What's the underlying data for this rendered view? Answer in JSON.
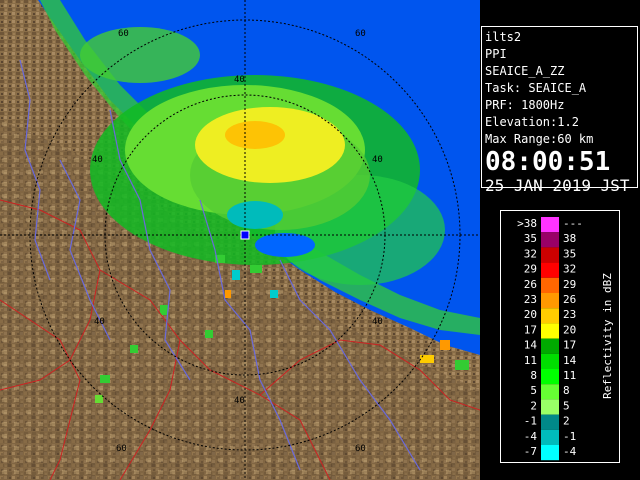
{
  "info": {
    "product": "ilts2",
    "mode": "PPI",
    "scan": "SEAICE_A_ZZ",
    "task": "Task: SEAICE_A",
    "prf": "PRF: 1800Hz",
    "elevation": "Elevation:1.2",
    "max_range": "Max Range:60 km",
    "time": "08:00:51",
    "date": "25 JAN 2019 JST"
  },
  "map": {
    "range_labels": [
      {
        "ring": 60,
        "text": "60"
      },
      {
        "ring": 40,
        "text": "40"
      },
      {
        "ring": 40,
        "text": "40"
      },
      {
        "ring": 60,
        "text": "60"
      },
      {
        "ring": 40,
        "text": "40"
      },
      {
        "ring": 40,
        "text": "40"
      },
      {
        "ring": 40,
        "text": "40"
      },
      {
        "ring": 60,
        "text": "60"
      },
      {
        "ring": 60,
        "text": "60"
      }
    ]
  },
  "legend": {
    "title": "Reflectivity in dBZ",
    "rows": [
      {
        "low": ">38",
        "high": "---",
        "color": "#ff33ff"
      },
      {
        "low": "35",
        "high": "38",
        "color": "#990066"
      },
      {
        "low": "32",
        "high": "35",
        "color": "#cc0000"
      },
      {
        "low": "29",
        "high": "32",
        "color": "#ff0000"
      },
      {
        "low": "26",
        "high": "29",
        "color": "#ff6600"
      },
      {
        "low": "23",
        "high": "26",
        "color": "#ff9900"
      },
      {
        "low": "20",
        "high": "23",
        "color": "#ffcc00"
      },
      {
        "low": "17",
        "high": "20",
        "color": "#ffff00"
      },
      {
        "low": "14",
        "high": "17",
        "color": "#00aa00"
      },
      {
        "low": "11",
        "high": "14",
        "color": "#00dd00"
      },
      {
        "low": "8",
        "high": "11",
        "color": "#00ff00"
      },
      {
        "low": "5",
        "high": "8",
        "color": "#66ff33"
      },
      {
        "low": "2",
        "high": "5",
        "color": "#99ff66"
      },
      {
        "low": "-1",
        "high": "2",
        "color": "#008888"
      },
      {
        "low": "-4",
        "high": "-1",
        "color": "#00bbbb"
      },
      {
        "low": "-7",
        "high": "-4",
        "color": "#00ffff"
      }
    ]
  },
  "colors": {
    "sea": "#0055ee",
    "land": "#8a6e48",
    "range_ring": "#000000"
  }
}
